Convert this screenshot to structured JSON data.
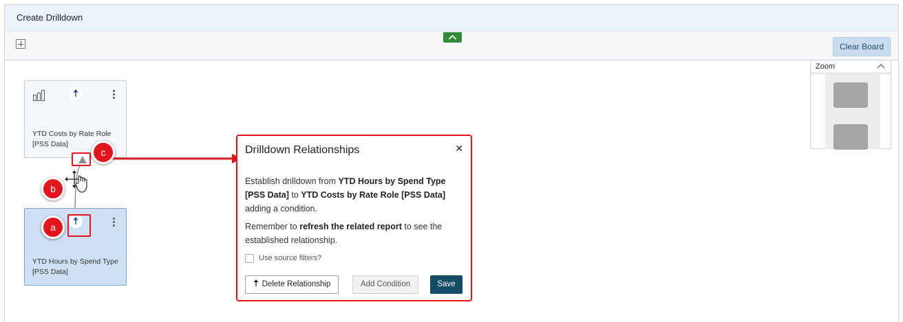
{
  "window": {
    "title": "Create Drilldown"
  },
  "toolbar": {
    "clear_board_label": "Clear Board"
  },
  "zoom": {
    "label": "Zoom"
  },
  "cards": [
    {
      "label_line1": "YTD Costs by Rate Role",
      "label_line2": "[PSS Data]"
    },
    {
      "label_line1": "YTD Hours by Spend Type",
      "label_line2": "[PSS Data]"
    }
  ],
  "callouts": {
    "a": "a",
    "b": "b",
    "c": "c"
  },
  "dialog": {
    "title": "Drilldown Relationships",
    "close_label": "✕",
    "p1_prefix": "Establish drilldown from ",
    "p1_source": "YTD Hours by Spend Type [PSS Data]",
    "p1_mid": " to ",
    "p1_target": "YTD Costs by Rate Role [PSS Data]",
    "p1_suffix": " adding a condition.",
    "p2_prefix": "Remember to ",
    "p2_bold": "refresh the related report",
    "p2_suffix": " to see the established relationship.",
    "checkbox_label": "Use source filters?",
    "delete_label": "Delete Relationship",
    "add_condition_label": "Add Condition",
    "save_label": "Save"
  },
  "colors": {
    "accent_red": "#e2141c",
    "save_blue": "#144c68",
    "green_toggle": "#2e8b3a",
    "selected_card": "#cfe0f4"
  }
}
